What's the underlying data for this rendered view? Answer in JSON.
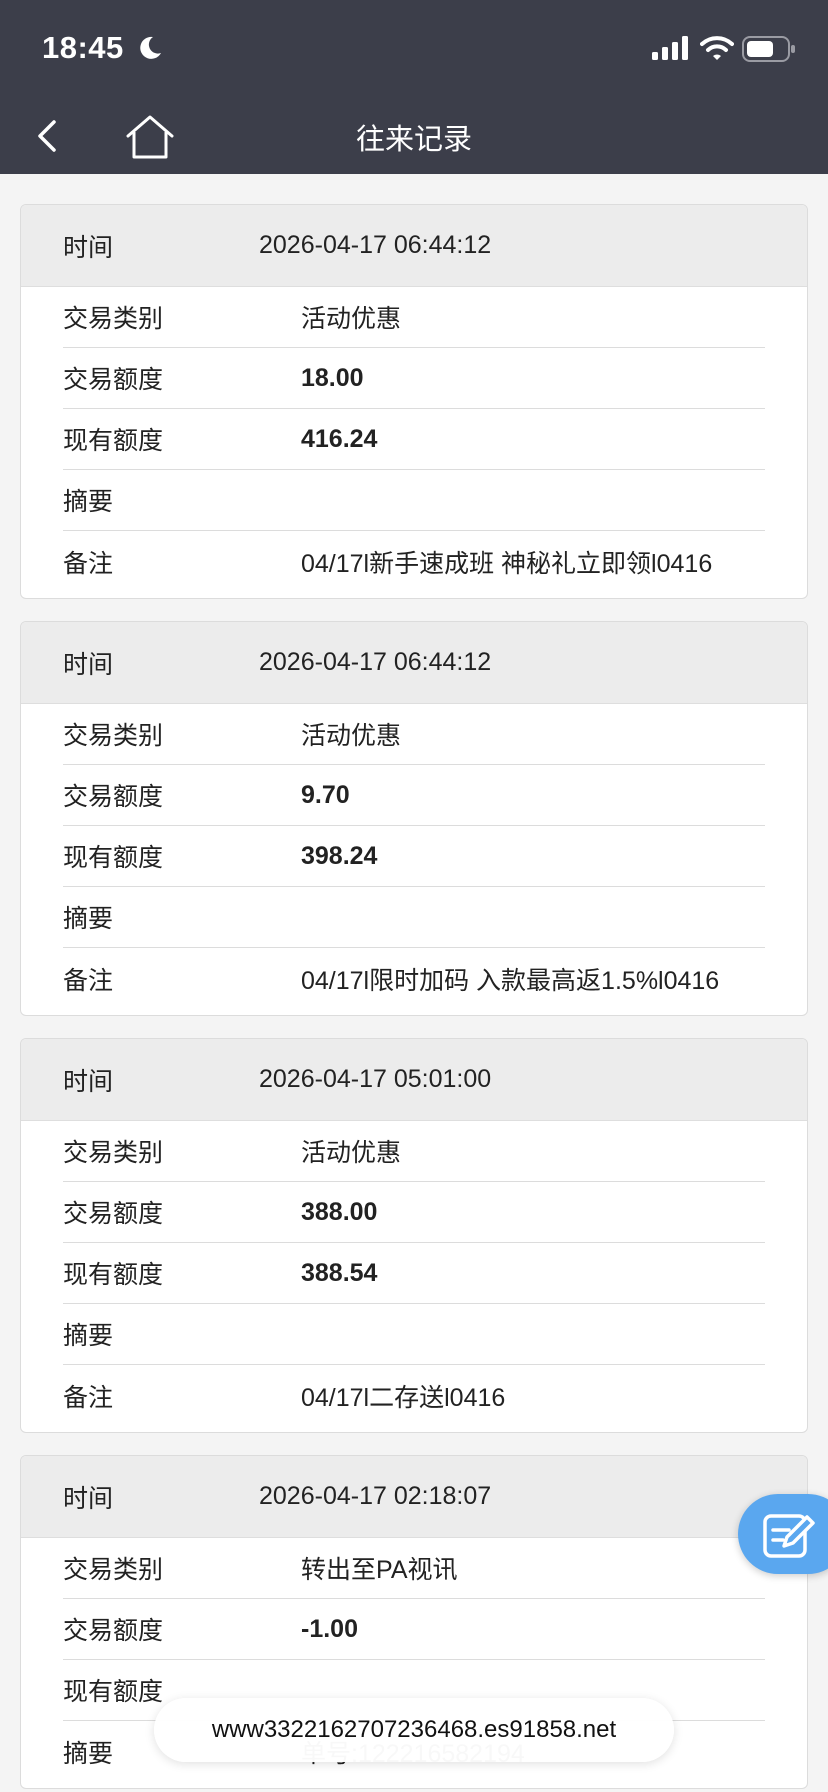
{
  "status_bar": {
    "time": "18:45",
    "icons": [
      "moon-icon",
      "signal-icon",
      "wifi-icon",
      "battery-icon"
    ]
  },
  "nav": {
    "title": "往来记录",
    "back_icon": "chevron-left-icon",
    "home_icon": "home-icon"
  },
  "records": [
    {
      "time_label": "时间",
      "time": "2026-04-17 06:44:12",
      "rows": [
        {
          "label": "交易类别",
          "value": "活动优惠",
          "bold": false
        },
        {
          "label": "交易额度",
          "value": "18.00",
          "bold": true
        },
        {
          "label": "现有额度",
          "value": "416.24",
          "bold": true
        },
        {
          "label": "摘要",
          "value": "",
          "bold": false
        },
        {
          "label": "备注",
          "value": "04/17l新手速成班 神秘礼立即领l0416",
          "bold": false
        }
      ]
    },
    {
      "time_label": "时间",
      "time": "2026-04-17 06:44:12",
      "rows": [
        {
          "label": "交易类别",
          "value": "活动优惠",
          "bold": false
        },
        {
          "label": "交易额度",
          "value": "9.70",
          "bold": true
        },
        {
          "label": "现有额度",
          "value": "398.24",
          "bold": true
        },
        {
          "label": "摘要",
          "value": "",
          "bold": false
        },
        {
          "label": "备注",
          "value": "04/17l限时加码 入款最高返1.5%l0416",
          "bold": false
        }
      ]
    },
    {
      "time_label": "时间",
      "time": "2026-04-17 05:01:00",
      "rows": [
        {
          "label": "交易类别",
          "value": "活动优惠",
          "bold": false
        },
        {
          "label": "交易额度",
          "value": "388.00",
          "bold": true
        },
        {
          "label": "现有额度",
          "value": "388.54",
          "bold": true
        },
        {
          "label": "摘要",
          "value": "",
          "bold": false
        },
        {
          "label": "备注",
          "value": "04/17l二存送l0416",
          "bold": false
        }
      ]
    },
    {
      "time_label": "时间",
      "time": "2026-04-17 02:18:07",
      "rows": [
        {
          "label": "交易类别",
          "value": "转出至PA视讯",
          "bold": false
        },
        {
          "label": "交易额度",
          "value": "-1.00",
          "bold": true
        },
        {
          "label": "现有额度",
          "value": "",
          "bold": true
        },
        {
          "label": "摘要",
          "value": "单号:122216582194",
          "bold": false
        }
      ]
    }
  ],
  "fab": {
    "icon": "edit-icon"
  },
  "toast": {
    "text": "www3322162707236468.es91858.net"
  }
}
